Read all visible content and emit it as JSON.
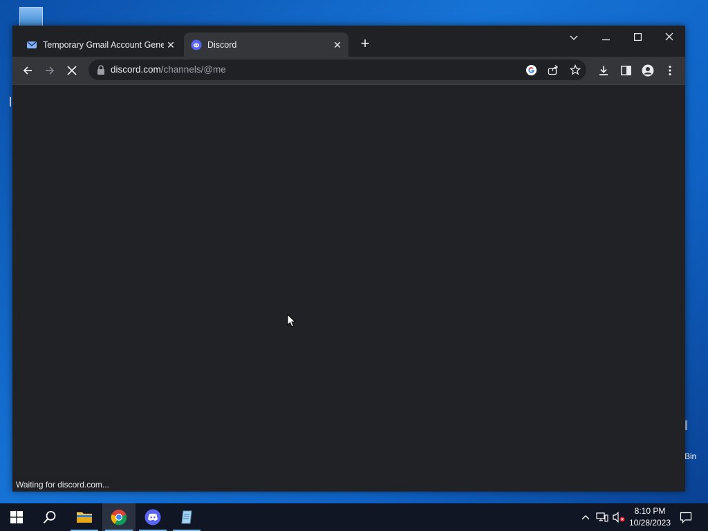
{
  "browser": {
    "tabs": [
      {
        "title": "Temporary Gmail Account Generator",
        "active": false
      },
      {
        "title": "Discord",
        "active": true
      }
    ],
    "address": {
      "domain": "discord.com",
      "path": "/channels/@me"
    },
    "status_text": "Waiting for discord.com...",
    "loading": true
  },
  "desktop": {
    "recycle_bin_partial_label": "Bin"
  },
  "taskbar": {
    "pinned": [
      "start-icon",
      "search-icon",
      "file-explorer-icon",
      "chrome-icon",
      "discord-icon",
      "notepad-icon"
    ],
    "clock_time": "8:10 PM",
    "clock_date": "10/28/2023"
  }
}
